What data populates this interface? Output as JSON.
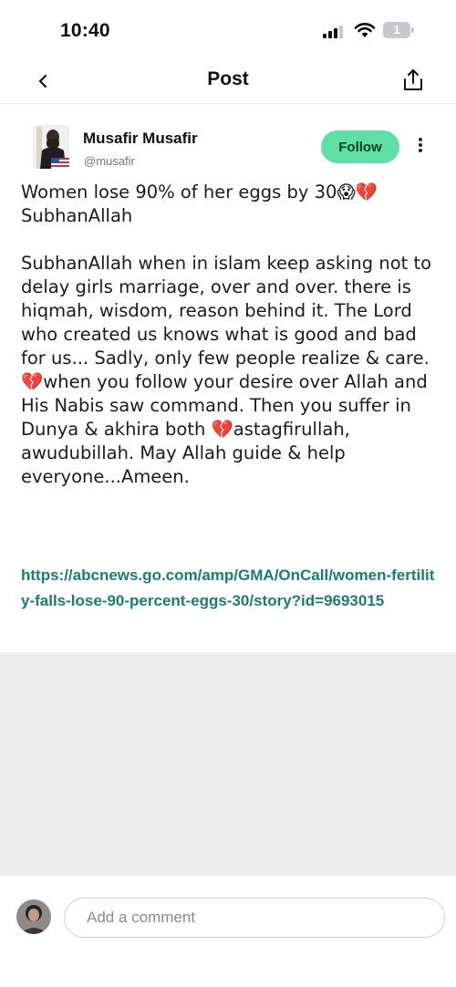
{
  "status_bar": {
    "time": "10:40",
    "battery_level": "1"
  },
  "nav": {
    "title": "Post"
  },
  "post": {
    "author_name": "Musafir Musafir",
    "author_handle": "@musafir",
    "follow_label": "Follow",
    "body": "Women lose 90% of her eggs by 30😱💔\nSubhanAllah\n\nSubhanAllah when in islam keep asking not to delay girls marriage, over and over. there is hiqmah, wisdom, reason behind it. The Lord who created us knows what is good and bad for us... Sadly, only few people realize & care. 💔when you follow your desire over Allah and His Nabis saw command. Then you suffer in Dunya & akhira both 💔astagfirullah, awudubillah. May Allah guide & help everyone...Ameen.",
    "link": "https://abcnews.go.com/amp/GMA/OnCall/women-fertility-falls-lose-90-percent-eggs-30/story?id=9693015"
  },
  "comment": {
    "placeholder": "Add a comment"
  },
  "colors": {
    "accent_green": "#5ee0a4",
    "link_teal": "#1a7c77",
    "background_gray": "#efeeef"
  }
}
